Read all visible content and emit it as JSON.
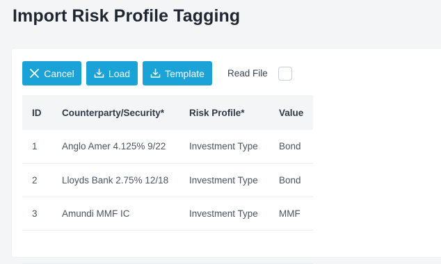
{
  "page": {
    "title": "Import Risk Profile Tagging"
  },
  "toolbar": {
    "cancel_label": "Cancel",
    "load_label": "Load",
    "template_label": "Template",
    "read_file_label": "Read File",
    "read_file_checked": false
  },
  "colors": {
    "accent": "#1ba3d7",
    "header_bg": "#f3f5f7",
    "card_bg": "#ffffff"
  },
  "icons": {
    "cancel": "close-icon",
    "load": "download-icon",
    "template": "download-icon"
  },
  "table": {
    "headers": {
      "id": "ID",
      "counterparty": "Counterparty/Security*",
      "risk_profile": "Risk Profile*",
      "value": "Value"
    },
    "rows": [
      {
        "id": "1",
        "counterparty": "Anglo Amer 4.125% 9/22",
        "risk_profile": "Investment Type",
        "value": "Bond"
      },
      {
        "id": "2",
        "counterparty": "Lloyds Bank 2.75% 12/18",
        "risk_profile": "Investment Type",
        "value": "Bond"
      },
      {
        "id": "3",
        "counterparty": "Amundi MMF IC",
        "risk_profile": "Investment Type",
        "value": "MMF"
      },
      {
        "id": "",
        "counterparty": "",
        "risk_profile": "",
        "value": ""
      }
    ]
  }
}
